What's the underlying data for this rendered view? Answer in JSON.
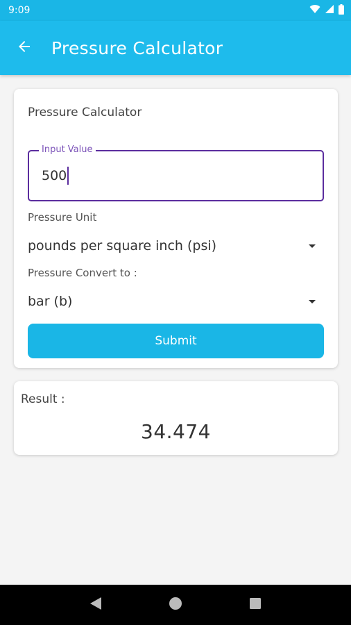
{
  "status_bar": {
    "time": "9:09"
  },
  "app_bar": {
    "title": "Pressure Calculator"
  },
  "form": {
    "card_title": "Pressure Calculator",
    "input_label": "Input Value",
    "input_value": "500",
    "unit_label": "Pressure Unit",
    "unit_selected": "pounds per square inch (psi)",
    "convert_label": "Pressure Convert to :",
    "convert_selected": "bar (b)",
    "submit_label": "Submit"
  },
  "result": {
    "label": "Result :",
    "value": "34.474"
  },
  "colors": {
    "primary": "#1ebbec",
    "status_bar": "#1ab6e6",
    "input_border": "#5b2d9e",
    "background": "#f4f4f4"
  },
  "icons": {
    "back": "arrow-back-icon",
    "wifi": "wifi-icon",
    "signal": "signal-icon",
    "battery": "battery-icon",
    "nav_back": "nav-back-icon",
    "nav_home": "nav-home-icon",
    "nav_recents": "nav-recents-icon"
  }
}
